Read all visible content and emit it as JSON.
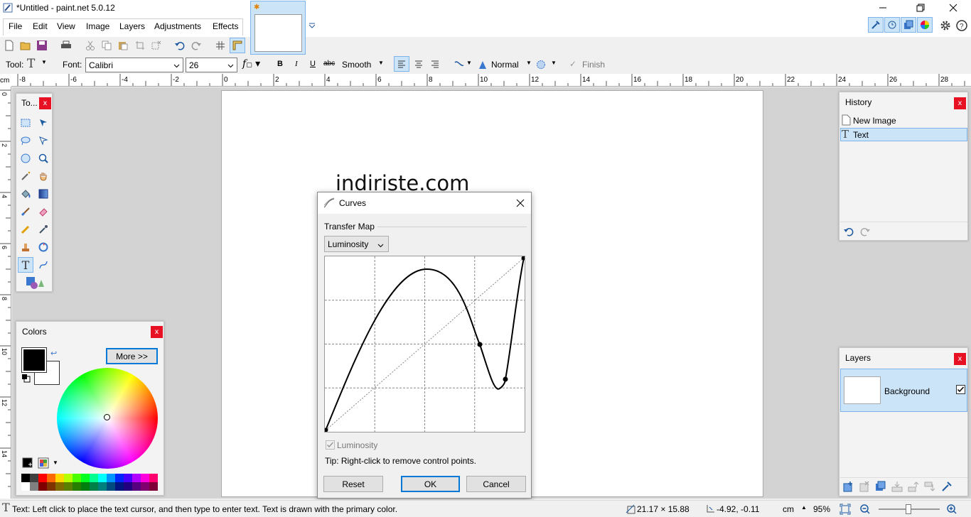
{
  "window": {
    "title": "*Untitled - paint.net 5.0.12"
  },
  "menu": [
    "File",
    "Edit",
    "View",
    "Image",
    "Layers",
    "Adjustments",
    "Effects"
  ],
  "toolbar": {
    "tool_label": "Tool:",
    "font_label": "Font:",
    "font_value": "Calibri",
    "size_value": "26",
    "bold": "B",
    "italic": "I",
    "underline": "U",
    "strike": "abc",
    "smoothing": "Smooth",
    "blend_mode": "Normal",
    "finish": "Finish"
  },
  "ruler": {
    "unit": "cm",
    "h_ticks": [
      "-8",
      "-6",
      "-4",
      "-2",
      "0",
      "2",
      "4",
      "6",
      "8",
      "10",
      "12",
      "14",
      "16",
      "18",
      "20",
      "22",
      "24",
      "26",
      "28"
    ],
    "v_ticks": [
      "0",
      "2",
      "4",
      "6",
      "8",
      "10",
      "12",
      "14"
    ]
  },
  "canvas_text": "indiriste.com",
  "tools_panel": {
    "title": "To..."
  },
  "colors_panel": {
    "title": "Colors",
    "more_button": "More >>"
  },
  "history_panel": {
    "title": "History",
    "items": [
      "New Image",
      "Text"
    ]
  },
  "layers_panel": {
    "title": "Layers",
    "layer_name": "Background"
  },
  "curves": {
    "title": "Curves",
    "section": "Transfer Map",
    "mode": "Luminosity",
    "checkbox_label": "Luminosity",
    "tip": "Tip: Right-click to remove control points.",
    "reset": "Reset",
    "ok": "OK",
    "cancel": "Cancel"
  },
  "status": {
    "message": "Text: Left click to place the text cursor, and then type to enter text. Text is drawn with the primary color.",
    "size": "21.17 × 15.88",
    "position": "-4.92, -0.11",
    "unit": "cm",
    "zoom": "95%"
  },
  "colors": {
    "accent": "#0078d7",
    "selection": "#cce4f7",
    "close_red": "#e81123"
  }
}
